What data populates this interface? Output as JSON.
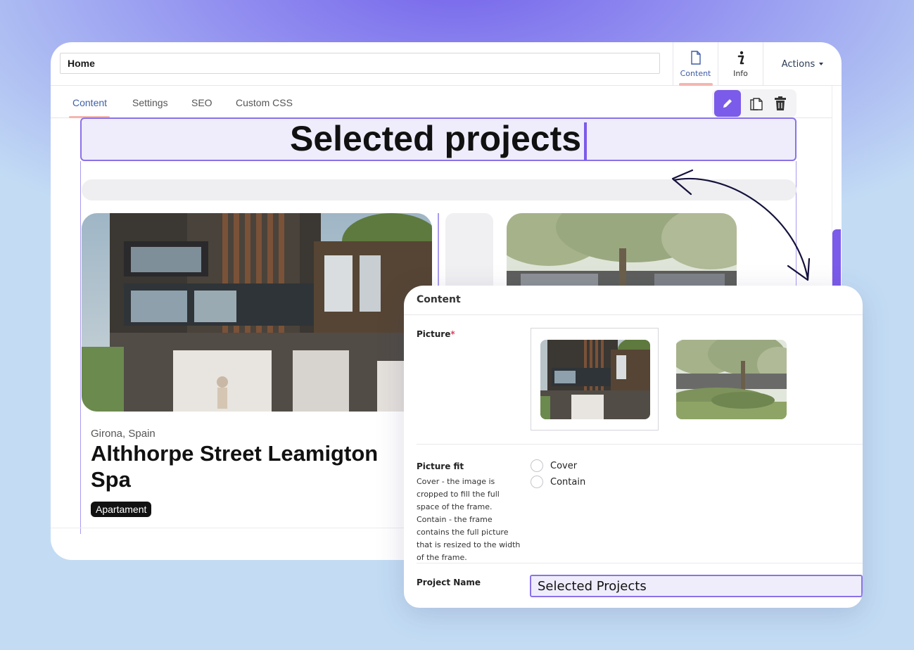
{
  "editor": {
    "page_name": "Home",
    "top_tabs": [
      {
        "label": "Content",
        "icon": "document-icon"
      },
      {
        "label": "Info",
        "icon": "info-icon"
      }
    ],
    "actions_label": "Actions",
    "sub_tabs": [
      "Content",
      "Settings",
      "SEO",
      "Custom CSS"
    ],
    "active_sub_tab": "Content",
    "toolbar": [
      "pencil-icon",
      "duplicate-icon",
      "trash-icon"
    ]
  },
  "canvas": {
    "section_heading": "Selected projects",
    "project": {
      "location": "Girona, Spain",
      "title": "Althhorpe Street Leamigton Spa",
      "tag": "Apartament"
    }
  },
  "panel": {
    "title": "Content",
    "picture_label": "Picture",
    "required_mark": "*",
    "picture_fit_label": "Picture fit",
    "picture_fit_description": "Cover - the image is cropped to fill the full space of the frame. Contain - the frame contains the full picture that is resized to the width of the frame.",
    "fit_options": [
      "Cover",
      "Contain"
    ],
    "project_name_label": "Project Name",
    "project_name_value": "Selected Projects"
  },
  "colors": {
    "accent": "#7b5bea",
    "tab_active": "#3f62a8",
    "underline": "#f4b6b0"
  }
}
